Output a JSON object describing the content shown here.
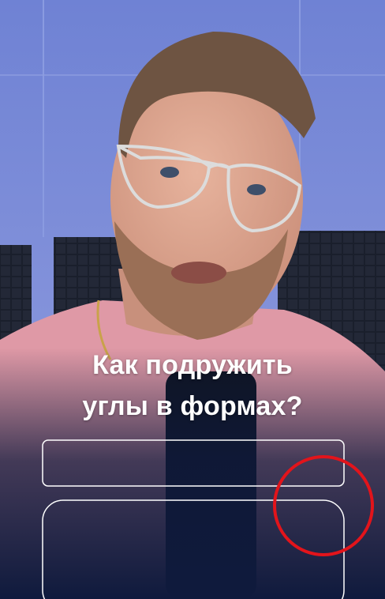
{
  "video": {
    "caption_line1": "Как подружить",
    "caption_line2": "углы в формах?"
  },
  "colors": {
    "wall": "#7e8fd8",
    "panel": "#1c2130",
    "shirt": "#e09aa8",
    "bottom": "#101b40",
    "outline": "#ffffff",
    "circle": "#e2141b"
  }
}
